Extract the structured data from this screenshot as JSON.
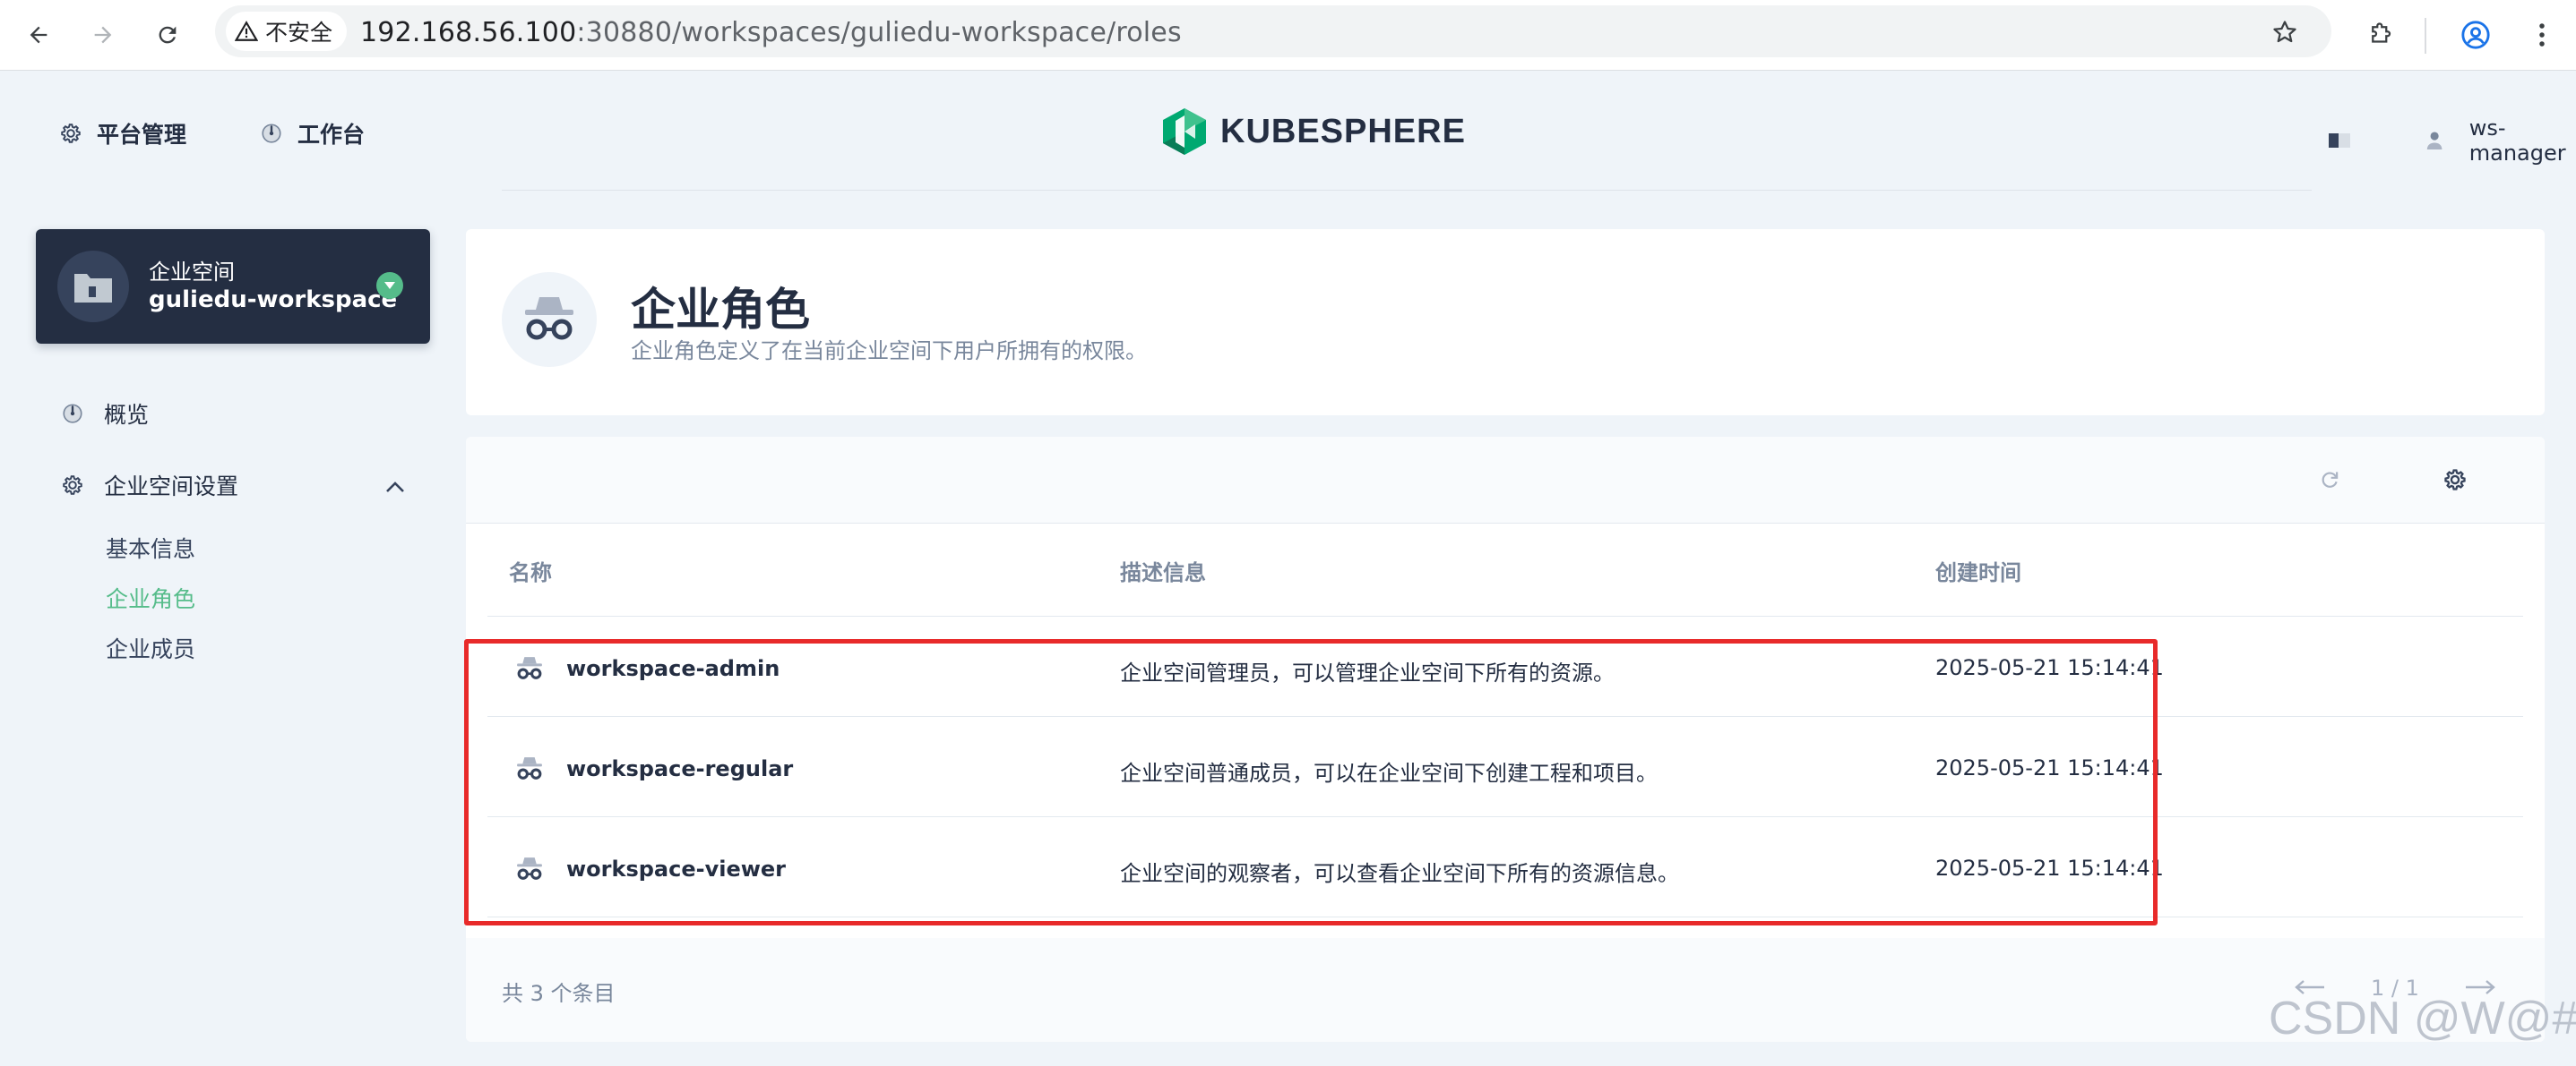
{
  "browser": {
    "security_label": "不安全",
    "url_host": "192.168.56.100",
    "url_path": ":30880/workspaces/guliedu-workspace/roles"
  },
  "header": {
    "nav": [
      {
        "label": "平台管理",
        "icon": "gear-icon"
      },
      {
        "label": "工作台",
        "icon": "dashboard-icon"
      }
    ],
    "logo_text": "KUBESPHERE",
    "username": "ws-manager"
  },
  "sidebar": {
    "workspace_label": "企业空间",
    "workspace_name": "guliedu-workspace",
    "items": [
      {
        "label": "概览",
        "icon": "dashboard-icon"
      },
      {
        "label": "企业空间设置",
        "icon": "gear-icon",
        "expanded": true
      }
    ],
    "sub_items": [
      {
        "label": "基本信息",
        "active": false
      },
      {
        "label": "企业角色",
        "active": true
      },
      {
        "label": "企业成员",
        "active": false
      }
    ]
  },
  "banner": {
    "title": "企业角色",
    "description": "企业角色定义了在当前企业空间下用户所拥有的权限。"
  },
  "table": {
    "columns": [
      "名称",
      "描述信息",
      "创建时间"
    ],
    "rows": [
      {
        "name": "workspace-admin",
        "description": "企业空间管理员，可以管理企业空间下所有的资源。",
        "created": "2025-05-21 15:14:41"
      },
      {
        "name": "workspace-regular",
        "description": "企业空间普通成员，可以在企业空间下创建工程和项目。",
        "created": "2025-05-21 15:14:41"
      },
      {
        "name": "workspace-viewer",
        "description": "企业空间的观察者，可以查看企业空间下所有的资源信息。",
        "created": "2025-05-21 15:14:41"
      }
    ],
    "total_text": "共 3 个条目",
    "page_text": "1 / 1"
  },
  "watermark": "CSDN @W@#",
  "colors": {
    "accent": "#55bc8a",
    "dark": "#242e42",
    "highlight": "#e82a2a",
    "background": "#eff4f9"
  }
}
